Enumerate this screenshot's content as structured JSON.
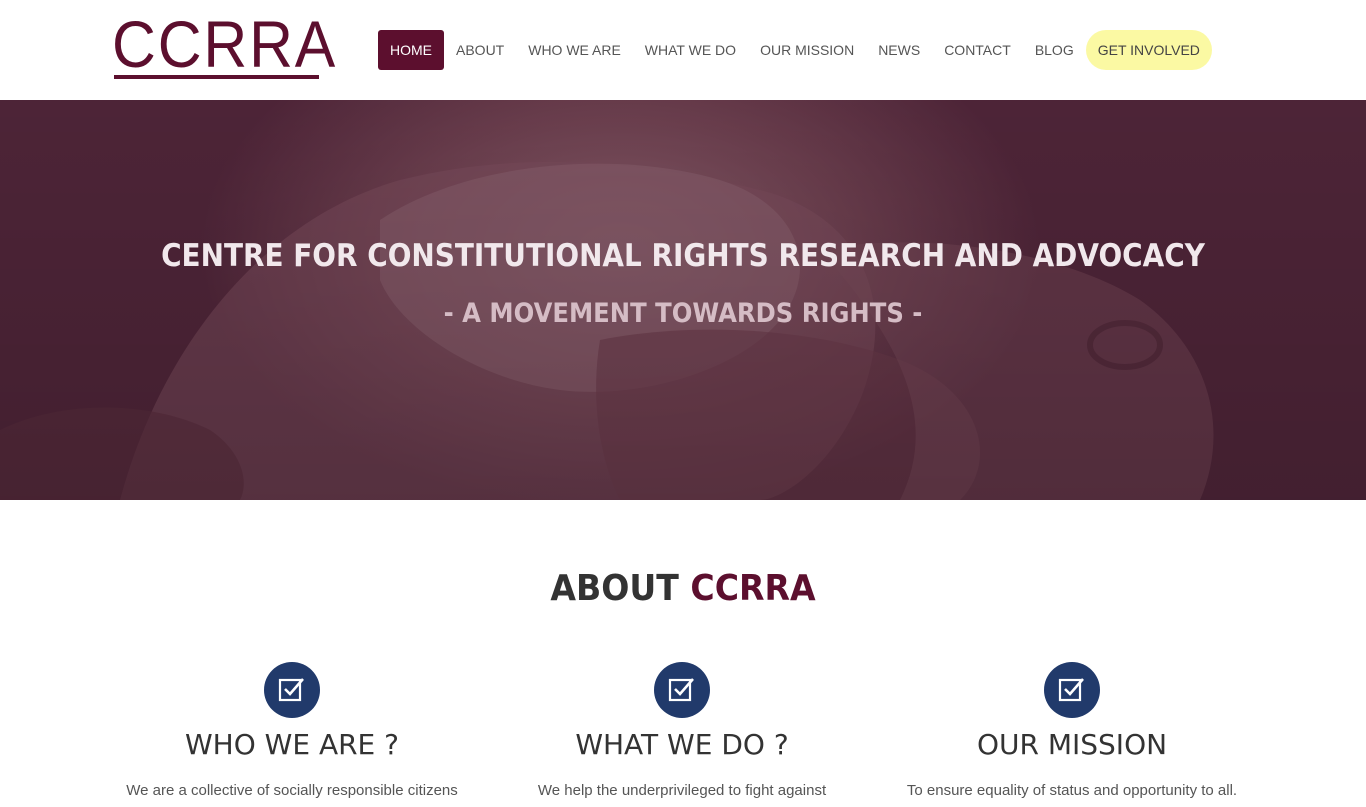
{
  "brand": {
    "logo": "CCRRA",
    "brand_color": "#5c0f2e",
    "accent_icon_color": "#213a6b",
    "cta_color": "#fbf9a3"
  },
  "nav": {
    "items": [
      {
        "label": "HOME",
        "active": true
      },
      {
        "label": "ABOUT"
      },
      {
        "label": "WHO WE ARE"
      },
      {
        "label": "WHAT WE DO"
      },
      {
        "label": "OUR MISSION"
      },
      {
        "label": "NEWS"
      },
      {
        "label": "CONTACT"
      },
      {
        "label": "BLOG"
      }
    ],
    "cta": "GET INVOLVED"
  },
  "hero": {
    "title": "CENTRE FOR CONSTITUTIONAL RIGHTS RESEARCH AND ADVOCACY",
    "subtitle": "- A MOVEMENT TOWARDS RIGHTS -"
  },
  "about": {
    "title_prefix": "ABOUT",
    "title_accent": "CCRRA",
    "columns": [
      {
        "icon": "checkbox-icon",
        "heading": "WHO WE ARE ?",
        "text": "We are a collective of socially responsible citizens from"
      },
      {
        "icon": "checkbox-icon",
        "heading": "WHAT WE DO ?",
        "text": "We help the underprivileged to fight against"
      },
      {
        "icon": "checkbox-icon",
        "heading": "OUR MISSION",
        "text": "To ensure equality of status and opportunity to all. To"
      }
    ]
  }
}
